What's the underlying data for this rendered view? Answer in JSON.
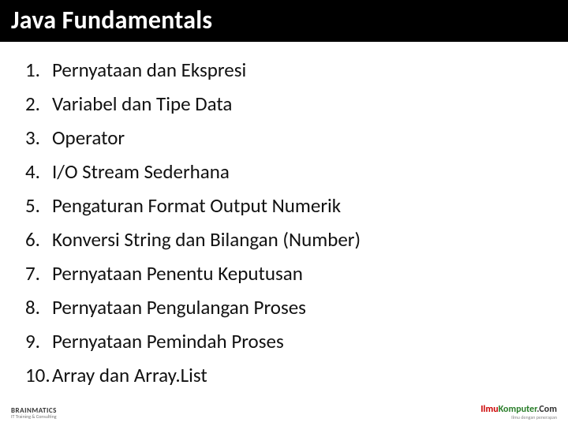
{
  "title": "Java Fundamentals",
  "items": [
    {
      "n": "1.",
      "t": "Pernyataan dan Ekspresi"
    },
    {
      "n": "2.",
      "t": "Variabel dan  Tipe Data"
    },
    {
      "n": "3.",
      "t": "Operator"
    },
    {
      "n": "4.",
      "t": "I/O Stream Sederhana"
    },
    {
      "n": "5.",
      "t": "Pengaturan Format  Output Numerik"
    },
    {
      "n": "6.",
      "t": "Konversi String dan Bilangan (Number)"
    },
    {
      "n": "7.",
      "t": "Pernyataan Penentu Keputusan"
    },
    {
      "n": "8.",
      "t": "Pernyataan Pengulangan Proses"
    },
    {
      "n": "9.",
      "t": "Pernyataan Pemindah Proses"
    },
    {
      "n": "10.",
      "t": "Array dan Array.List"
    }
  ],
  "footer": {
    "left_brand": "BRAINMATICS",
    "left_tag": "IT Training & Consulting",
    "right_ilmu": "Ilmu",
    "right_komp": "Komputer",
    "right_com": ".Com",
    "right_tag": "Ilmu dengan penerapan"
  }
}
